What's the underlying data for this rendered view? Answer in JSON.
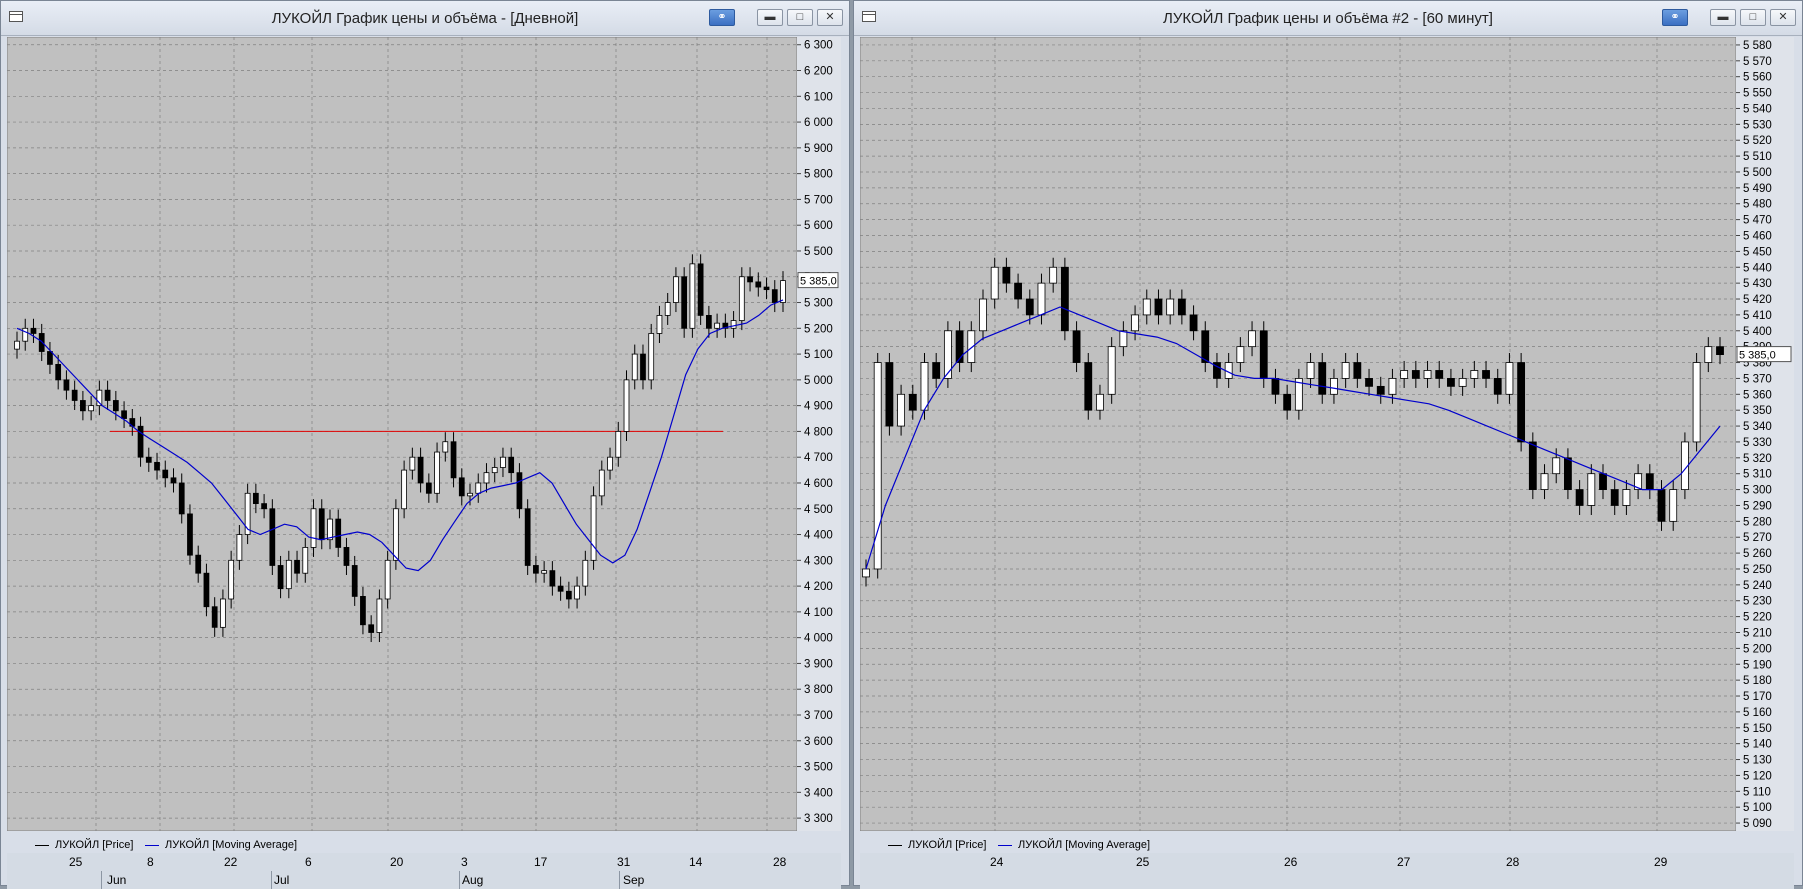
{
  "windows": [
    {
      "title": "ЛУКОЙЛ График цены и объёма - [Дневной]",
      "legend": [
        "ЛУКОЙЛ [Price]",
        "ЛУКОЙЛ [Moving Average]"
      ],
      "price_tag": "5 385,0",
      "time_labels": [
        "25",
        "8",
        "22",
        "6",
        "20",
        "3",
        "17",
        "31",
        "14",
        "28"
      ],
      "month_labels": [
        "Jun",
        "Jul",
        "Aug",
        "Sep"
      ],
      "chart_data": {
        "type": "candlestick",
        "ylim": [
          3250,
          6330
        ],
        "y_ticks": [
          3300,
          3400,
          3500,
          3600,
          3700,
          3800,
          3900,
          4000,
          4100,
          4200,
          4300,
          4400,
          4500,
          4600,
          4700,
          4800,
          4900,
          5000,
          5100,
          5200,
          5300,
          5400,
          5500,
          5600,
          5700,
          5800,
          5900,
          6000,
          6100,
          6200,
          6300
        ],
        "y_tick_labels": [
          "3 300",
          "3 400",
          "3 500",
          "3 600",
          "3 700",
          "3 800",
          "3 900",
          "4 000",
          "4 100",
          "4 200",
          "4 300",
          "4 400",
          "4 500",
          "4 600",
          "4 700",
          "4 800",
          "4 900",
          "5 000",
          "5 100",
          "5 200",
          "5 300",
          "5 400",
          "5 500",
          "5 600",
          "5 700",
          "5 800",
          "5 900",
          "6 000",
          "6 100",
          "6 200",
          "6 300"
        ],
        "horizontal_line": 4800,
        "close": [
          5150,
          5200,
          5180,
          5110,
          5060,
          5000,
          4960,
          4920,
          4880,
          4900,
          4960,
          4920,
          4880,
          4850,
          4820,
          4700,
          4680,
          4650,
          4620,
          4600,
          4480,
          4320,
          4250,
          4120,
          4040,
          4150,
          4300,
          4400,
          4560,
          4520,
          4500,
          4280,
          4190,
          4300,
          4250,
          4350,
          4500,
          4380,
          4460,
          4350,
          4280,
          4160,
          4050,
          4020,
          4150,
          4300,
          4500,
          4650,
          4700,
          4600,
          4560,
          4720,
          4760,
          4620,
          4550,
          4560,
          4600,
          4640,
          4660,
          4700,
          4640,
          4500,
          4280,
          4250,
          4260,
          4200,
          4180,
          4150,
          4200,
          4300,
          4550,
          4650,
          4700,
          4800,
          5000,
          5100,
          5000,
          5180,
          5250,
          5300,
          5400,
          5200,
          5450,
          5250,
          5200,
          5220,
          5200,
          5230,
          5400,
          5380,
          5360,
          5350,
          5300,
          5385
        ],
        "ma": [
          5200,
          5180,
          5150,
          5100,
          5050,
          5000,
          4950,
          4900,
          4870,
          4840,
          4800,
          4770,
          4740,
          4710,
          4680,
          4640,
          4600,
          4540,
          4480,
          4420,
          4400,
          4420,
          4440,
          4430,
          4390,
          4380,
          4390,
          4400,
          4410,
          4400,
          4370,
          4320,
          4270,
          4260,
          4300,
          4380,
          4450,
          4520,
          4560,
          4580,
          4590,
          4600,
          4620,
          4640,
          4600,
          4520,
          4440,
          4380,
          4320,
          4290,
          4320,
          4420,
          4560,
          4700,
          4860,
          5020,
          5120,
          5180,
          5200,
          5210,
          5220,
          5250,
          5290,
          5310
        ],
        "legend": [
          "ЛУКОЙЛ [Price]",
          "ЛУКОЙЛ [Moving Average]"
        ]
      }
    },
    {
      "title": "ЛУКОЙЛ График цены и объёма #2 - [60 минут]",
      "legend": [
        "ЛУКОЙЛ [Price]",
        "ЛУКОЙЛ [Moving Average]"
      ],
      "price_tag": "5 385,0",
      "time_labels": [
        "24",
        "25",
        "26",
        "27",
        "28",
        "29"
      ],
      "chart_data": {
        "type": "candlestick",
        "ylim": [
          5085,
          5585
        ],
        "y_ticks": [
          5090,
          5100,
          5110,
          5120,
          5130,
          5140,
          5150,
          5160,
          5170,
          5180,
          5190,
          5200,
          5210,
          5220,
          5230,
          5240,
          5250,
          5260,
          5270,
          5280,
          5290,
          5300,
          5310,
          5320,
          5330,
          5340,
          5350,
          5360,
          5370,
          5380,
          5390,
          5400,
          5410,
          5420,
          5430,
          5440,
          5450,
          5460,
          5470,
          5480,
          5490,
          5500,
          5510,
          5520,
          5530,
          5540,
          5550,
          5560,
          5570,
          5580
        ],
        "y_tick_labels": [
          "5 090",
          "5 100",
          "5 110",
          "5 120",
          "5 130",
          "5 140",
          "5 150",
          "5 160",
          "5 170",
          "5 180",
          "5 190",
          "5 200",
          "5 210",
          "5 220",
          "5 230",
          "5 240",
          "5 250",
          "5 260",
          "5 270",
          "5 280",
          "5 290",
          "5 300",
          "5 310",
          "5 320",
          "5 330",
          "5 340",
          "5 350",
          "5 360",
          "5 370",
          "5 380",
          "5 390",
          "5 400",
          "5 410",
          "5 420",
          "5 430",
          "5 440",
          "5 450",
          "5 460",
          "5 470",
          "5 480",
          "5 490",
          "5 500",
          "5 510",
          "5 520",
          "5 530",
          "5 540",
          "5 550",
          "5 560",
          "5 570",
          "5 580"
        ],
        "close": [
          5250,
          5380,
          5340,
          5360,
          5350,
          5380,
          5370,
          5400,
          5380,
          5400,
          5420,
          5440,
          5430,
          5420,
          5410,
          5430,
          5440,
          5400,
          5380,
          5350,
          5360,
          5390,
          5400,
          5410,
          5420,
          5410,
          5420,
          5410,
          5400,
          5380,
          5370,
          5380,
          5390,
          5400,
          5370,
          5360,
          5350,
          5370,
          5380,
          5360,
          5370,
          5380,
          5370,
          5365,
          5360,
          5370,
          5375,
          5370,
          5375,
          5370,
          5365,
          5370,
          5375,
          5370,
          5360,
          5380,
          5330,
          5300,
          5310,
          5320,
          5300,
          5290,
          5310,
          5300,
          5290,
          5300,
          5310,
          5300,
          5280,
          5300,
          5330,
          5380,
          5390,
          5385
        ],
        "ma": [
          5250,
          5290,
          5320,
          5350,
          5370,
          5385,
          5395,
          5400,
          5405,
          5410,
          5415,
          5410,
          5405,
          5400,
          5398,
          5396,
          5392,
          5385,
          5378,
          5372,
          5370,
          5370,
          5368,
          5366,
          5364,
          5362,
          5360,
          5358,
          5356,
          5354,
          5350,
          5345,
          5340,
          5335,
          5330,
          5325,
          5320,
          5315,
          5310,
          5305,
          5300,
          5300,
          5310,
          5325,
          5340
        ],
        "legend": [
          "ЛУКОЙЛ [Price]",
          "ЛУКОЙЛ [Moving Average]"
        ]
      }
    }
  ]
}
